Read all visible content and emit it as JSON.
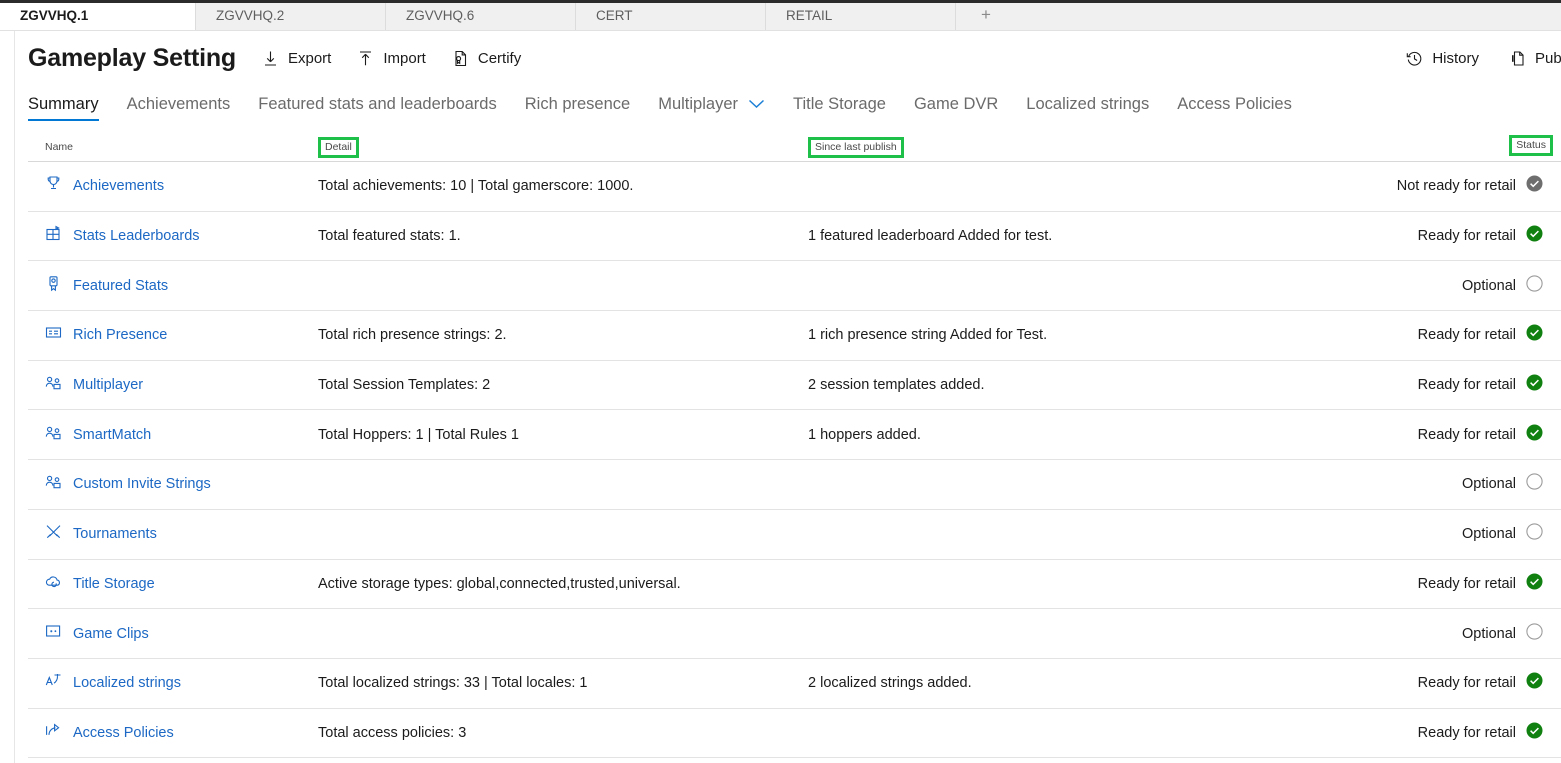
{
  "window": {
    "tabs": [
      {
        "label": "ZGVVHQ.1",
        "active": true
      },
      {
        "label": "ZGVVHQ.2",
        "active": false
      },
      {
        "label": "ZGVVHQ.6",
        "active": false
      },
      {
        "label": "CERT",
        "active": false
      },
      {
        "label": "RETAIL",
        "active": false
      }
    ],
    "new_tab_label": "+"
  },
  "header": {
    "title": "Gameplay Setting",
    "commands": [
      {
        "label": "Export",
        "icon": "download-icon"
      },
      {
        "label": "Import",
        "icon": "upload-icon"
      },
      {
        "label": "Certify",
        "icon": "certificate-icon"
      }
    ],
    "right_commands": [
      {
        "label": "History",
        "icon": "history-icon"
      },
      {
        "label": "Publish",
        "icon": "publish-icon"
      }
    ]
  },
  "pivots": [
    {
      "label": "Summary",
      "active": true,
      "chevron": false
    },
    {
      "label": "Achievements",
      "active": false,
      "chevron": false
    },
    {
      "label": "Featured stats and leaderboards",
      "active": false,
      "chevron": false
    },
    {
      "label": "Rich presence",
      "active": false,
      "chevron": false
    },
    {
      "label": "Multiplayer",
      "active": false,
      "chevron": true
    },
    {
      "label": "Title Storage",
      "active": false,
      "chevron": false
    },
    {
      "label": "Game DVR",
      "active": false,
      "chevron": false
    },
    {
      "label": "Localized strings",
      "active": false,
      "chevron": false
    },
    {
      "label": "Access Policies",
      "active": false,
      "chevron": false
    }
  ],
  "table": {
    "columns": [
      {
        "label": "Name",
        "highlighted": false
      },
      {
        "label": "Detail",
        "highlighted": true
      },
      {
        "label": "Since last publish",
        "highlighted": true
      },
      {
        "label": "Status",
        "highlighted": true
      }
    ],
    "highlight_color": "#1fc04a",
    "rows": [
      {
        "icon": "trophy-icon",
        "name": "Achievements",
        "detail": "Total achievements: 10 | Total gamerscore: 1000.",
        "since_last_publish": "",
        "status": "Not ready for retail",
        "status_icon": "check-circle-gray-icon"
      },
      {
        "icon": "leaderboard-icon",
        "name": "Stats Leaderboards",
        "detail": "Total featured stats: 1.",
        "since_last_publish": "1 featured leaderboard Added for test.",
        "status": "Ready for retail",
        "status_icon": "check-circle-green-icon"
      },
      {
        "icon": "ribbon-icon",
        "name": "Featured Stats",
        "detail": "",
        "since_last_publish": "",
        "status": "Optional",
        "status_icon": "empty-circle-icon"
      },
      {
        "icon": "id-card-icon",
        "name": "Rich Presence",
        "detail": "Total rich presence strings: 2.",
        "since_last_publish": "1 rich presence string Added for Test.",
        "status": "Ready for retail",
        "status_icon": "check-circle-green-icon"
      },
      {
        "icon": "people-icon",
        "name": "Multiplayer",
        "detail": "Total Session Templates: 2",
        "since_last_publish": "2 session templates added.",
        "status": "Ready for retail",
        "status_icon": "check-circle-green-icon"
      },
      {
        "icon": "people-icon",
        "name": "SmartMatch",
        "detail": "Total Hoppers: 1 | Total Rules 1",
        "since_last_publish": "1 hoppers added.",
        "status": "Ready for retail",
        "status_icon": "check-circle-green-icon"
      },
      {
        "icon": "people-icon",
        "name": "Custom Invite Strings",
        "detail": "",
        "since_last_publish": "",
        "status": "Optional",
        "status_icon": "empty-circle-icon"
      },
      {
        "icon": "tournament-icon",
        "name": "Tournaments",
        "detail": "",
        "since_last_publish": "",
        "status": "Optional",
        "status_icon": "empty-circle-icon"
      },
      {
        "icon": "cloud-storage-icon",
        "name": "Title Storage",
        "detail": "Active storage types: global,connected,trusted,universal.",
        "since_last_publish": "",
        "status": "Ready for retail",
        "status_icon": "check-circle-green-icon"
      },
      {
        "icon": "game-clip-icon",
        "name": "Game Clips",
        "detail": "",
        "since_last_publish": "",
        "status": "Optional",
        "status_icon": "empty-circle-icon"
      },
      {
        "icon": "translate-icon",
        "name": "Localized strings",
        "detail": "Total localized strings: 33 | Total locales: 1",
        "since_last_publish": "2 localized strings added.",
        "status": "Ready for retail",
        "status_icon": "check-circle-green-icon"
      },
      {
        "icon": "share-icon",
        "name": "Access Policies",
        "detail": "Total access policies: 3",
        "since_last_publish": "",
        "status": "Ready for retail",
        "status_icon": "check-circle-green-icon"
      }
    ]
  }
}
